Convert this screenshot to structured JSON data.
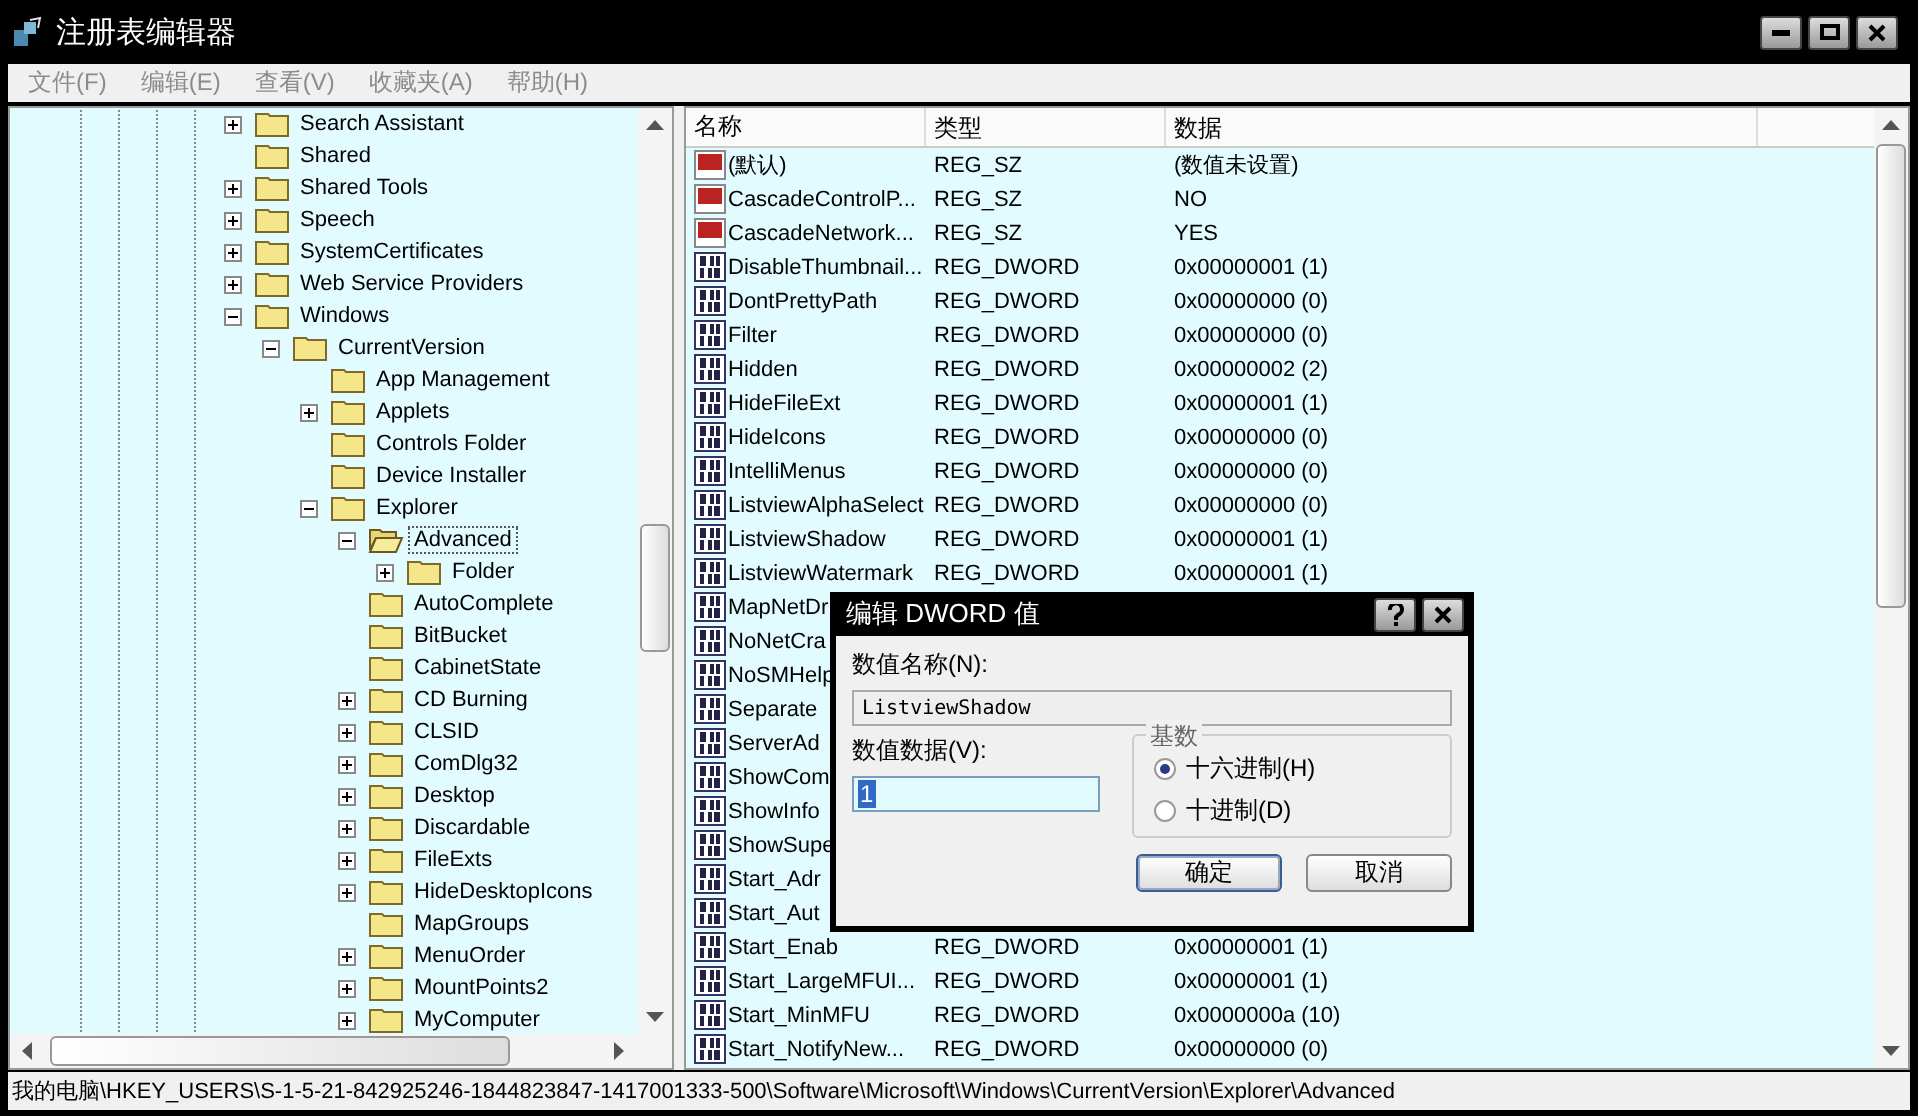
{
  "window": {
    "title": "注册表编辑器"
  },
  "menu": [
    {
      "label": "文件(F)",
      "disabled": true
    },
    {
      "label": "编辑(E)",
      "disabled": true
    },
    {
      "label": "查看(V)",
      "disabled": true
    },
    {
      "label": "收藏夹(A)",
      "disabled": true
    },
    {
      "label": "帮助(H)",
      "disabled": true
    }
  ],
  "tree": [
    {
      "label": "Search Assistant",
      "kind": "collapsed",
      "selected": false
    },
    {
      "label": "Shared",
      "kind": "leaf",
      "selected": false
    },
    {
      "label": "Shared Tools",
      "kind": "collapsed",
      "selected": false
    },
    {
      "label": "Speech",
      "kind": "collapsed",
      "selected": false
    },
    {
      "label": "SystemCertificates",
      "kind": "collapsed",
      "selected": false
    },
    {
      "label": "Web Service Providers",
      "kind": "collapsed",
      "selected": false
    },
    {
      "label": "Windows",
      "kind": "expanded",
      "selected": false,
      "children": [
        {
          "label": "CurrentVersion",
          "kind": "expanded",
          "selected": false,
          "children": [
            {
              "label": "App Management",
              "kind": "leaf",
              "selected": false
            },
            {
              "label": "Applets",
              "kind": "collapsed",
              "selected": false
            },
            {
              "label": "Controls Folder",
              "kind": "leaf",
              "selected": false
            },
            {
              "label": "Device Installer",
              "kind": "leaf",
              "selected": false
            },
            {
              "label": "Explorer",
              "kind": "expanded",
              "selected": false,
              "children": [
                {
                  "label": "Advanced",
                  "kind": "expanded",
                  "selected": true,
                  "children": [
                    {
                      "label": "Folder",
                      "kind": "collapsed",
                      "selected": false
                    }
                  ]
                },
                {
                  "label": "AutoComplete",
                  "kind": "leaf",
                  "selected": false
                },
                {
                  "label": "BitBucket",
                  "kind": "leaf",
                  "selected": false
                },
                {
                  "label": "CabinetState",
                  "kind": "leaf",
                  "selected": false
                },
                {
                  "label": "CD Burning",
                  "kind": "collapsed",
                  "selected": false
                },
                {
                  "label": "CLSID",
                  "kind": "collapsed",
                  "selected": false
                },
                {
                  "label": "ComDlg32",
                  "kind": "collapsed",
                  "selected": false
                },
                {
                  "label": "Desktop",
                  "kind": "collapsed",
                  "selected": false
                },
                {
                  "label": "Discardable",
                  "kind": "collapsed",
                  "selected": false
                },
                {
                  "label": "FileExts",
                  "kind": "collapsed",
                  "selected": false
                },
                {
                  "label": "HideDesktopIcons",
                  "kind": "collapsed",
                  "selected": false
                },
                {
                  "label": "MapGroups",
                  "kind": "leaf",
                  "selected": false
                },
                {
                  "label": "MenuOrder",
                  "kind": "collapsed",
                  "selected": false
                },
                {
                  "label": "MountPoints2",
                  "kind": "collapsed",
                  "selected": false
                },
                {
                  "label": "MyComputer",
                  "kind": "collapsed",
                  "selected": false
                }
              ]
            }
          ]
        }
      ]
    }
  ],
  "list": {
    "columns": [
      "名称",
      "类型",
      "数据"
    ],
    "rows": [
      {
        "kind": "string",
        "name": "(默认)",
        "type": "REG_SZ",
        "data": "(数值未设置)"
      },
      {
        "kind": "string",
        "name": "CascadeControlP...",
        "type": "REG_SZ",
        "data": "NO"
      },
      {
        "kind": "string",
        "name": "CascadeNetwork...",
        "type": "REG_SZ",
        "data": "YES"
      },
      {
        "kind": "dword",
        "name": "DisableThumbnail...",
        "type": "REG_DWORD",
        "data": "0x00000001 (1)"
      },
      {
        "kind": "dword",
        "name": "DontPrettyPath",
        "type": "REG_DWORD",
        "data": "0x00000000 (0)"
      },
      {
        "kind": "dword",
        "name": "Filter",
        "type": "REG_DWORD",
        "data": "0x00000000 (0)"
      },
      {
        "kind": "dword",
        "name": "Hidden",
        "type": "REG_DWORD",
        "data": "0x00000002 (2)"
      },
      {
        "kind": "dword",
        "name": "HideFileExt",
        "type": "REG_DWORD",
        "data": "0x00000001 (1)"
      },
      {
        "kind": "dword",
        "name": "HideIcons",
        "type": "REG_DWORD",
        "data": "0x00000000 (0)"
      },
      {
        "kind": "dword",
        "name": "IntelliMenus",
        "type": "REG_DWORD",
        "data": "0x00000000 (0)"
      },
      {
        "kind": "dword",
        "name": "ListviewAlphaSelect",
        "type": "REG_DWORD",
        "data": "0x00000000 (0)"
      },
      {
        "kind": "dword",
        "name": "ListviewShadow",
        "type": "REG_DWORD",
        "data": "0x00000001 (1)"
      },
      {
        "kind": "dword",
        "name": "ListviewWatermark",
        "type": "REG_DWORD",
        "data": "0x00000001 (1)"
      },
      {
        "kind": "dword",
        "name": "MapNetDr"
      },
      {
        "kind": "dword",
        "name": "NoNetCra"
      },
      {
        "kind": "dword",
        "name": "NoSMHelp"
      },
      {
        "kind": "dword",
        "name": "Separate"
      },
      {
        "kind": "dword",
        "name": "ServerAd"
      },
      {
        "kind": "dword",
        "name": "ShowCom"
      },
      {
        "kind": "dword",
        "name": "ShowInfo"
      },
      {
        "kind": "dword",
        "name": "ShowSupe"
      },
      {
        "kind": "dword",
        "name": "Start_Adr"
      },
      {
        "kind": "dword",
        "name": "Start_Aut"
      },
      {
        "kind": "dword",
        "name": "Start_Enab",
        "type": "REG_DWORD",
        "data": "0x00000001 (1)"
      },
      {
        "kind": "dword",
        "name": "Start_LargeMFUI...",
        "type": "REG_DWORD",
        "data": "0x00000001 (1)"
      },
      {
        "kind": "dword",
        "name": "Start_MinMFU",
        "type": "REG_DWORD",
        "data": "0x0000000a (10)"
      },
      {
        "kind": "dword",
        "name": "Start_NotifyNew...",
        "type": "REG_DWORD",
        "data": "0x00000000 (0)"
      }
    ]
  },
  "status_bar": "我的电脑\\HKEY_USERS\\S-1-5-21-842925246-1844823847-1417001333-500\\Software\\Microsoft\\Windows\\CurrentVersion\\Explorer\\Advanced",
  "dialog": {
    "title": "编辑 DWORD 值",
    "name_label": "数值名称(N):",
    "name_value": "ListviewShadow",
    "data_label": "数值数据(V):",
    "data_value": "1",
    "base_label": "基数",
    "bases": [
      {
        "label": "十六进制(H)",
        "selected": true
      },
      {
        "label": "十进制(D)",
        "selected": false
      }
    ],
    "buttons": [
      {
        "label": "确定",
        "default": true
      },
      {
        "label": "取消",
        "default": false
      }
    ]
  }
}
